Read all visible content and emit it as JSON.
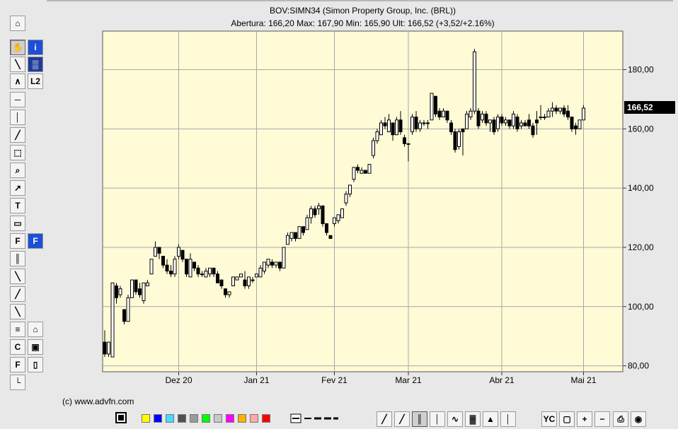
{
  "chart_data": {
    "type": "candlestick",
    "title": "BOV:SIMN34 (Simon Property Group, Inc. (BRL))",
    "subtitle": "Abertura: 166,20 Max: 167,90 Min: 165,90 Ult: 166,52 (+3,52/+2.16%)",
    "y_ticks": [
      "80,00",
      "100,00",
      "120,00",
      "140,00",
      "160,00",
      "180,00"
    ],
    "ylim": [
      78,
      193
    ],
    "x_ticks": [
      "Dez 20",
      "Jan 21",
      "Fev 21",
      "Mar 21",
      "Abr 21",
      "Mai 21"
    ],
    "x_tick_index": [
      19,
      39,
      59,
      78,
      102,
      123
    ],
    "last_price": "166,52",
    "grid": true,
    "candles": [
      {
        "o": 88,
        "h": 92,
        "l": 83,
        "c": 84
      },
      {
        "o": 84,
        "h": 88,
        "l": 83,
        "c": 88
      },
      {
        "o": 83,
        "h": 108,
        "l": 83,
        "c": 108
      },
      {
        "o": 107,
        "h": 108,
        "l": 101,
        "c": 103
      },
      {
        "o": 104,
        "h": 107,
        "l": 103,
        "c": 106
      },
      {
        "o": 99,
        "h": 99,
        "l": 94,
        "c": 95
      },
      {
        "o": 95,
        "h": 104,
        "l": 95,
        "c": 103
      },
      {
        "o": 103,
        "h": 109,
        "l": 103,
        "c": 109
      },
      {
        "o": 109,
        "h": 109,
        "l": 104,
        "c": 105
      },
      {
        "o": 106,
        "h": 108,
        "l": 103,
        "c": 104
      },
      {
        "o": 102,
        "h": 108,
        "l": 101,
        "c": 108
      },
      {
        "o": 107,
        "h": 109,
        "l": 107,
        "c": 108
      },
      {
        "o": 111,
        "h": 116,
        "l": 111,
        "c": 116
      },
      {
        "o": 117,
        "h": 122,
        "l": 117,
        "c": 120
      },
      {
        "o": 120,
        "h": 120,
        "l": 116,
        "c": 118
      },
      {
        "o": 117,
        "h": 117,
        "l": 113,
        "c": 114
      },
      {
        "o": 114,
        "h": 116,
        "l": 111,
        "c": 112
      },
      {
        "o": 112,
        "h": 114,
        "l": 110,
        "c": 111
      },
      {
        "o": 111,
        "h": 117,
        "l": 110,
        "c": 116
      },
      {
        "o": 117,
        "h": 121,
        "l": 116,
        "c": 120
      },
      {
        "o": 119,
        "h": 119,
        "l": 115,
        "c": 116
      },
      {
        "o": 116,
        "h": 116,
        "l": 110,
        "c": 111
      },
      {
        "o": 110,
        "h": 118,
        "l": 110,
        "c": 116
      },
      {
        "o": 115,
        "h": 115,
        "l": 112,
        "c": 113
      },
      {
        "o": 113,
        "h": 114,
        "l": 110,
        "c": 111
      },
      {
        "o": 111,
        "h": 112,
        "l": 110,
        "c": 111
      },
      {
        "o": 110,
        "h": 113,
        "l": 110,
        "c": 112
      },
      {
        "o": 111,
        "h": 113,
        "l": 110,
        "c": 113
      },
      {
        "o": 113,
        "h": 113,
        "l": 110,
        "c": 111
      },
      {
        "o": 111,
        "h": 112,
        "l": 108,
        "c": 108
      },
      {
        "o": 109,
        "h": 109,
        "l": 106,
        "c": 107
      },
      {
        "o": 106,
        "h": 106,
        "l": 103,
        "c": 104
      },
      {
        "o": 104,
        "h": 105,
        "l": 103,
        "c": 105
      },
      {
        "o": 107,
        "h": 110,
        "l": 107,
        "c": 110
      },
      {
        "o": 109,
        "h": 110,
        "l": 109,
        "c": 110
      },
      {
        "o": 110,
        "h": 111,
        "l": 110,
        "c": 111
      },
      {
        "o": 109,
        "h": 112,
        "l": 106,
        "c": 107
      },
      {
        "o": 107,
        "h": 110,
        "l": 106,
        "c": 110
      },
      {
        "o": 109,
        "h": 110,
        "l": 108,
        "c": 109
      },
      {
        "o": 110,
        "h": 111,
        "l": 110,
        "c": 111
      },
      {
        "o": 110,
        "h": 114,
        "l": 110,
        "c": 113
      },
      {
        "o": 112,
        "h": 115,
        "l": 111,
        "c": 115
      },
      {
        "o": 114,
        "h": 116,
        "l": 113,
        "c": 116
      },
      {
        "o": 115,
        "h": 116,
        "l": 113,
        "c": 114
      },
      {
        "o": 114,
        "h": 115,
        "l": 113,
        "c": 115
      },
      {
        "o": 115,
        "h": 115,
        "l": 112,
        "c": 113
      },
      {
        "o": 113,
        "h": 120,
        "l": 113,
        "c": 120
      },
      {
        "o": 121,
        "h": 125,
        "l": 121,
        "c": 124
      },
      {
        "o": 123,
        "h": 125,
        "l": 122,
        "c": 125
      },
      {
        "o": 125,
        "h": 125,
        "l": 122,
        "c": 123
      },
      {
        "o": 123,
        "h": 127,
        "l": 123,
        "c": 127
      },
      {
        "o": 127,
        "h": 127,
        "l": 124,
        "c": 125
      },
      {
        "o": 126,
        "h": 131,
        "l": 126,
        "c": 130
      },
      {
        "o": 130,
        "h": 134,
        "l": 128,
        "c": 133
      },
      {
        "o": 133,
        "h": 134,
        "l": 130,
        "c": 131
      },
      {
        "o": 133,
        "h": 135,
        "l": 131,
        "c": 134
      },
      {
        "o": 134,
        "h": 134,
        "l": 127,
        "c": 128
      },
      {
        "o": 128,
        "h": 128,
        "l": 124,
        "c": 125
      },
      {
        "o": 124,
        "h": 124,
        "l": 123,
        "c": 123
      },
      {
        "o": 128,
        "h": 130,
        "l": 127,
        "c": 130
      },
      {
        "o": 129,
        "h": 131,
        "l": 128,
        "c": 131
      },
      {
        "o": 130,
        "h": 133,
        "l": 130,
        "c": 133
      },
      {
        "o": 135,
        "h": 139,
        "l": 134,
        "c": 138
      },
      {
        "o": 138,
        "h": 141,
        "l": 137,
        "c": 141
      },
      {
        "o": 143,
        "h": 147,
        "l": 142,
        "c": 147
      },
      {
        "o": 147,
        "h": 148,
        "l": 145,
        "c": 146
      },
      {
        "o": 145,
        "h": 147,
        "l": 145,
        "c": 146
      },
      {
        "o": 146,
        "h": 146,
        "l": 145,
        "c": 145
      },
      {
        "o": 145,
        "h": 148,
        "l": 145,
        "c": 148
      },
      {
        "o": 151,
        "h": 157,
        "l": 150,
        "c": 156
      },
      {
        "o": 156,
        "h": 160,
        "l": 155,
        "c": 159
      },
      {
        "o": 158,
        "h": 163,
        "l": 158,
        "c": 162
      },
      {
        "o": 162,
        "h": 164,
        "l": 160,
        "c": 161
      },
      {
        "o": 159,
        "h": 165,
        "l": 159,
        "c": 163
      },
      {
        "o": 162,
        "h": 162,
        "l": 156,
        "c": 158
      },
      {
        "o": 158,
        "h": 164,
        "l": 158,
        "c": 163
      },
      {
        "o": 163,
        "h": 166,
        "l": 158,
        "c": 159
      },
      {
        "o": 157,
        "h": 158,
        "l": 154,
        "c": 155
      },
      {
        "o": 155,
        "h": 155,
        "l": 149,
        "c": 155
      },
      {
        "o": 159,
        "h": 165,
        "l": 158,
        "c": 164
      },
      {
        "o": 164,
        "h": 166,
        "l": 159,
        "c": 160
      },
      {
        "o": 160,
        "h": 163,
        "l": 159,
        "c": 162
      },
      {
        "o": 162,
        "h": 163,
        "l": 161,
        "c": 162
      },
      {
        "o": 162,
        "h": 163,
        "l": 160,
        "c": 162
      },
      {
        "o": 163,
        "h": 172,
        "l": 163,
        "c": 172
      },
      {
        "o": 171,
        "h": 171,
        "l": 164,
        "c": 165
      },
      {
        "o": 166,
        "h": 167,
        "l": 163,
        "c": 164
      },
      {
        "o": 164,
        "h": 167,
        "l": 164,
        "c": 166
      },
      {
        "o": 166,
        "h": 166,
        "l": 162,
        "c": 163
      },
      {
        "o": 162,
        "h": 163,
        "l": 158,
        "c": 159
      },
      {
        "o": 159,
        "h": 160,
        "l": 152,
        "c": 153
      },
      {
        "o": 154,
        "h": 160,
        "l": 153,
        "c": 159
      },
      {
        "o": 160,
        "h": 160,
        "l": 151,
        "c": 159
      },
      {
        "o": 160,
        "h": 166,
        "l": 160,
        "c": 165
      },
      {
        "o": 164,
        "h": 167,
        "l": 163,
        "c": 166
      },
      {
        "o": 166,
        "h": 187,
        "l": 165,
        "c": 186
      },
      {
        "o": 166,
        "h": 167,
        "l": 160,
        "c": 161
      },
      {
        "o": 163,
        "h": 166,
        "l": 162,
        "c": 165
      },
      {
        "o": 165,
        "h": 166,
        "l": 161,
        "c": 162
      },
      {
        "o": 162,
        "h": 163,
        "l": 159,
        "c": 163
      },
      {
        "o": 163,
        "h": 164,
        "l": 158,
        "c": 159
      },
      {
        "o": 160,
        "h": 165,
        "l": 159,
        "c": 164
      },
      {
        "o": 164,
        "h": 165,
        "l": 161,
        "c": 162
      },
      {
        "o": 162,
        "h": 164,
        "l": 161,
        "c": 163
      },
      {
        "o": 163,
        "h": 163,
        "l": 160,
        "c": 161
      },
      {
        "o": 161,
        "h": 166,
        "l": 160,
        "c": 165
      },
      {
        "o": 164,
        "h": 165,
        "l": 159,
        "c": 160
      },
      {
        "o": 161,
        "h": 163,
        "l": 160,
        "c": 162
      },
      {
        "o": 162,
        "h": 163,
        "l": 161,
        "c": 161
      },
      {
        "o": 163,
        "h": 165,
        "l": 160,
        "c": 161
      },
      {
        "o": 161,
        "h": 162,
        "l": 157,
        "c": 158
      },
      {
        "o": 163,
        "h": 166,
        "l": 158,
        "c": 162
      },
      {
        "o": 164,
        "h": 168,
        "l": 163,
        "c": 164
      },
      {
        "o": 164,
        "h": 165,
        "l": 163,
        "c": 164
      },
      {
        "o": 164,
        "h": 167,
        "l": 164,
        "c": 166
      },
      {
        "o": 166,
        "h": 169,
        "l": 164,
        "c": 167
      },
      {
        "o": 167,
        "h": 168,
        "l": 165,
        "c": 166
      },
      {
        "o": 166,
        "h": 167,
        "l": 165,
        "c": 167
      },
      {
        "o": 167,
        "h": 168,
        "l": 164,
        "c": 165
      },
      {
        "o": 166,
        "h": 168,
        "l": 163,
        "c": 164
      },
      {
        "o": 164,
        "h": 164,
        "l": 159,
        "c": 160
      },
      {
        "o": 161,
        "h": 162,
        "l": 158,
        "c": 160
      },
      {
        "o": 160,
        "h": 163,
        "l": 160,
        "c": 163
      },
      {
        "o": 163,
        "h": 168,
        "l": 163,
        "c": 167
      }
    ]
  },
  "footer": {
    "copyright": "(c) www.advfn.com"
  },
  "left_tools": [
    {
      "id": "lock",
      "glyph": "⌂",
      "icon": "lock-icon"
    },
    {
      "id": "hand",
      "glyph": "✋",
      "icon": "hand-pointer-icon",
      "selected": true
    },
    {
      "id": "info",
      "glyph": "i",
      "icon": "info-icon",
      "accent": "#1f4fd6"
    },
    {
      "id": "line",
      "glyph": "╲",
      "icon": "trend-line-icon"
    },
    {
      "id": "studies",
      "glyph": "▒",
      "icon": "studies-icon",
      "accent": "#1f3a99"
    },
    {
      "id": "angle",
      "glyph": "∧",
      "icon": "angle-icon"
    },
    {
      "id": "l2",
      "glyph": "L2",
      "icon": "level2-icon"
    },
    {
      "id": "hline",
      "glyph": "─",
      "icon": "horizontal-line-icon"
    },
    {
      "id": "vline",
      "glyph": "│",
      "icon": "vertical-line-icon"
    },
    {
      "id": "channel",
      "glyph": "╱",
      "icon": "channel-icon"
    },
    {
      "id": "rect",
      "glyph": "⬚",
      "icon": "rectangle-select-icon"
    },
    {
      "id": "zoom",
      "glyph": "⌕",
      "icon": "zoom-tool-icon"
    },
    {
      "id": "arrow",
      "glyph": "↗",
      "icon": "arrow-tool-icon"
    },
    {
      "id": "text",
      "glyph": "T",
      "icon": "text-tool-icon"
    },
    {
      "id": "note",
      "glyph": "▭",
      "icon": "note-tool-icon"
    },
    {
      "id": "fib1",
      "glyph": "F",
      "icon": "fibonacci-icon"
    },
    {
      "id": "fib2",
      "glyph": "F",
      "icon": "fibonacci-blue-icon",
      "accent": "#1f4fd6"
    },
    {
      "id": "cycles",
      "glyph": "║",
      "icon": "cycle-lines-icon"
    },
    {
      "id": "fan",
      "glyph": "╲",
      "icon": "fan-lines-icon"
    },
    {
      "id": "pitch",
      "glyph": "╱",
      "icon": "pitchfork-icon"
    },
    {
      "id": "parallel",
      "glyph": "╲",
      "icon": "parallel-lines-icon"
    },
    {
      "id": "template",
      "glyph": "≡",
      "icon": "chart-template-icon"
    },
    {
      "id": "open",
      "glyph": "⌂",
      "icon": "open-folder-icon"
    },
    {
      "id": "compare",
      "glyph": "C",
      "icon": "compare-icon"
    },
    {
      "id": "save",
      "glyph": "▣",
      "icon": "save-disk-icon"
    },
    {
      "id": "fib3",
      "glyph": "F",
      "icon": "fibonacci-time-icon"
    },
    {
      "id": "page",
      "glyph": "▯",
      "icon": "new-page-icon"
    },
    {
      "id": "corner",
      "glyph": "└",
      "icon": "corner-tool-icon"
    }
  ],
  "colors": {
    "plot_bg": "#fffbd6",
    "grid": "#a8a8a8",
    "swatches": [
      "#ffff00",
      "#0000ff",
      "#44ddff",
      "#505050",
      "#9a9a9a",
      "#00ff00",
      "#c8c8c8",
      "#ff00ff",
      "#ffb000",
      "#ffaaaa",
      "#ff0000"
    ],
    "current_swatch": "#000000"
  },
  "bottom_tools": [
    {
      "glyph": "╱",
      "icon": "line-chart-icon"
    },
    {
      "glyph": "╱",
      "icon": "ohlc-line-icon"
    },
    {
      "glyph": "║",
      "icon": "candlestick-icon",
      "selected": true
    },
    {
      "glyph": "│",
      "icon": "ohlc-bar-icon"
    },
    {
      "glyph": "∿",
      "icon": "mountain-icon"
    },
    {
      "glyph": "▓",
      "icon": "heikin-ashi-icon"
    },
    {
      "glyph": "▲",
      "icon": "area-chart-icon"
    },
    {
      "glyph": "│",
      "icon": "hlc-bar-icon"
    },
    {
      "glyph": "YC",
      "icon": "yield-curve-icon"
    },
    {
      "glyph": "▢",
      "icon": "zoom-box-icon"
    },
    {
      "glyph": "+",
      "icon": "zoom-in-icon"
    },
    {
      "glyph": "−",
      "icon": "zoom-out-icon"
    },
    {
      "glyph": "⎙",
      "icon": "print-icon"
    },
    {
      "glyph": "◉",
      "icon": "screenshot-icon"
    }
  ]
}
